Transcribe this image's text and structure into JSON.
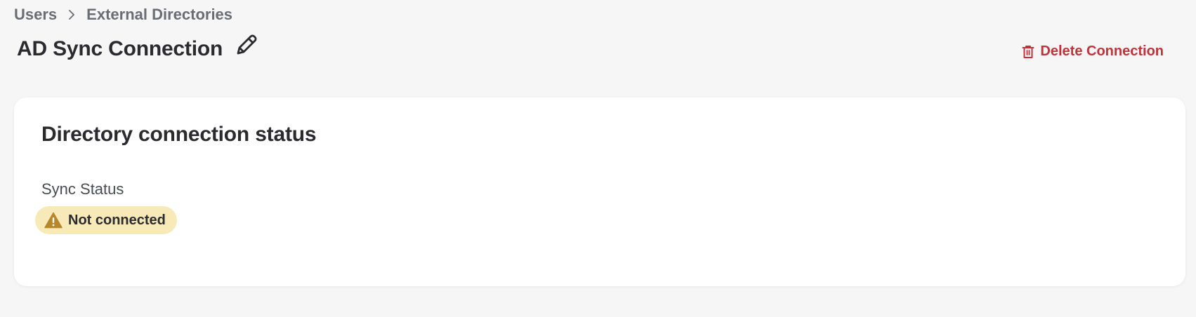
{
  "breadcrumb": {
    "items": [
      {
        "label": "Users"
      },
      {
        "label": "External Directories"
      }
    ],
    "separator_icon": "chevron-right-icon"
  },
  "header": {
    "title": "AD Sync Connection",
    "edit_icon": "pencil-icon",
    "delete_label": "Delete Connection",
    "delete_icon": "trash-icon"
  },
  "card": {
    "title": "Directory connection status",
    "sync_status_label": "Sync Status",
    "status_badge": {
      "label": "Not connected",
      "icon": "warning-icon"
    }
  },
  "colors": {
    "background": "#f6f6f6",
    "card": "#ffffff",
    "danger": "#c2323a",
    "warning_bg": "#f7eab8",
    "warning_icon": "#b8862b",
    "muted_text": "#6b6d75"
  }
}
